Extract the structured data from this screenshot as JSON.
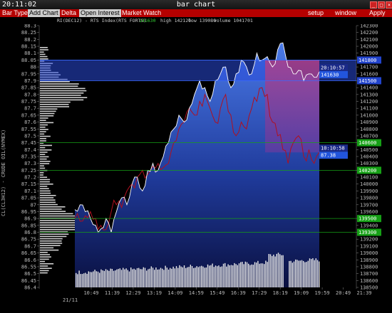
{
  "window": {
    "clock": "20:11:02",
    "title": "bar chart"
  },
  "titlebar_buttons": [
    "_",
    "□",
    "×"
  ],
  "menu": {
    "bar_type": "Bar Type",
    "add_chart": "Add Chart",
    "delta": "Delta",
    "open_interest": "Open Interest",
    "market_watch": "Market Watch",
    "setup": "setup",
    "window": "window",
    "apply": "Apply"
  },
  "info": {
    "symbol": "RI(DEC12) - RTS Index(RTS FORTS)",
    "last": "141630",
    "high": "high 142120",
    "low": "low 139080",
    "volume": "volume 1041701"
  },
  "side_label": "CL(CL3H12) - CRUDE OIL(NYMEX)",
  "date_label": "21/11",
  "colors": {
    "menu": "#b50000",
    "rts": "#ffffff",
    "crude": "#b01020",
    "area_top": "#4a7ae8",
    "area_bottom": "#0a1040",
    "green": "#16a016",
    "blue_tag": "#2244cc"
  },
  "chart_data": {
    "type": "line",
    "left_axis": {
      "label": "CL(CL3H12) - CRUDE OIL(NYMEX)",
      "ticks": [
        "88.3",
        "88.25",
        "88.2",
        "88.15",
        "88.1",
        "88.05",
        "88",
        "87.95",
        "87.9",
        "87.85",
        "87.8",
        "87.75",
        "87.7",
        "87.65",
        "87.6",
        "87.55",
        "87.5",
        "87.45",
        "87.4",
        "87.35",
        "87.3",
        "87.25",
        "87.2",
        "87.15",
        "87.1",
        "87.05",
        "87",
        "86.95",
        "86.9",
        "86.85",
        "86.8",
        "86.75",
        "86.7",
        "86.65",
        "86.6",
        "86.55",
        "86.5",
        "86.45",
        "86.4"
      ],
      "range": [
        86.4,
        88.3
      ]
    },
    "right_axis": {
      "ticks": [
        "142300",
        "142200",
        "142100",
        "142000",
        "141900",
        "141800",
        "141700",
        "141600",
        "141500",
        "141400",
        "141300",
        "141200",
        "141100",
        "141000",
        "140900",
        "140800",
        "140700",
        "140600",
        "140500",
        "140400",
        "140300",
        "140200",
        "140100",
        "140000",
        "139900",
        "139800",
        "139700",
        "139600",
        "139500",
        "139400",
        "139300",
        "139200",
        "139100",
        "139000",
        "138900",
        "138800",
        "138700",
        "138600",
        "138500"
      ],
      "range": [
        138500,
        142300
      ]
    },
    "x_ticks": [
      "10:49",
      "11:39",
      "12:29",
      "13:19",
      "14:09",
      "14:59",
      "15:49",
      "16:39",
      "17:29",
      "18:19",
      "19:09",
      "19:59",
      "20:49",
      "21:39"
    ],
    "series": [
      {
        "name": "RI(DEC12) - RTS Index(RTS FORTS)",
        "axis": "right",
        "values": [
          139630,
          139700,
          139600,
          139500,
          139400,
          139350,
          139500,
          139300,
          139600,
          139800,
          139700,
          140000,
          140100,
          139900,
          140200,
          140300,
          140200,
          140400,
          140600,
          140800,
          141000,
          140900,
          141100,
          141300,
          141500,
          141400,
          141200,
          141500,
          141600,
          141700,
          141400,
          141600,
          141800,
          141700,
          141600,
          141900,
          141800,
          141850,
          141700,
          141950,
          142050,
          141700,
          141600,
          141650,
          141500,
          141600,
          141550,
          141630
        ]
      },
      {
        "name": "CL(CL3H12) - CRUDE OIL(NYMEX)",
        "axis": "left",
        "values": [
          86.9,
          86.88,
          86.92,
          86.95,
          86.9,
          86.85,
          86.82,
          86.95,
          87.0,
          86.98,
          87.1,
          87.15,
          87.2,
          87.25,
          87.22,
          87.28,
          87.3,
          87.27,
          87.3,
          87.45,
          87.55,
          87.6,
          87.7,
          87.65,
          87.75,
          87.8,
          87.7,
          87.6,
          87.7,
          87.8,
          87.65,
          87.5,
          87.6,
          87.55,
          87.7,
          87.75,
          87.85,
          87.8,
          87.6,
          87.5,
          87.4,
          87.3,
          87.45,
          87.5,
          87.35,
          87.4,
          87.3,
          87.38
        ]
      }
    ],
    "markers": {
      "rts_high": "141800",
      "rts_last": "141630",
      "rts_low": "141500",
      "rts_time": "20:10:57",
      "crude_last": "87.38",
      "crude_time": "10:10:58",
      "rts_green": [
        "140600",
        "140200",
        "139500",
        "139300"
      ]
    },
    "volume": "bars at bottom (white)",
    "grid": false
  }
}
